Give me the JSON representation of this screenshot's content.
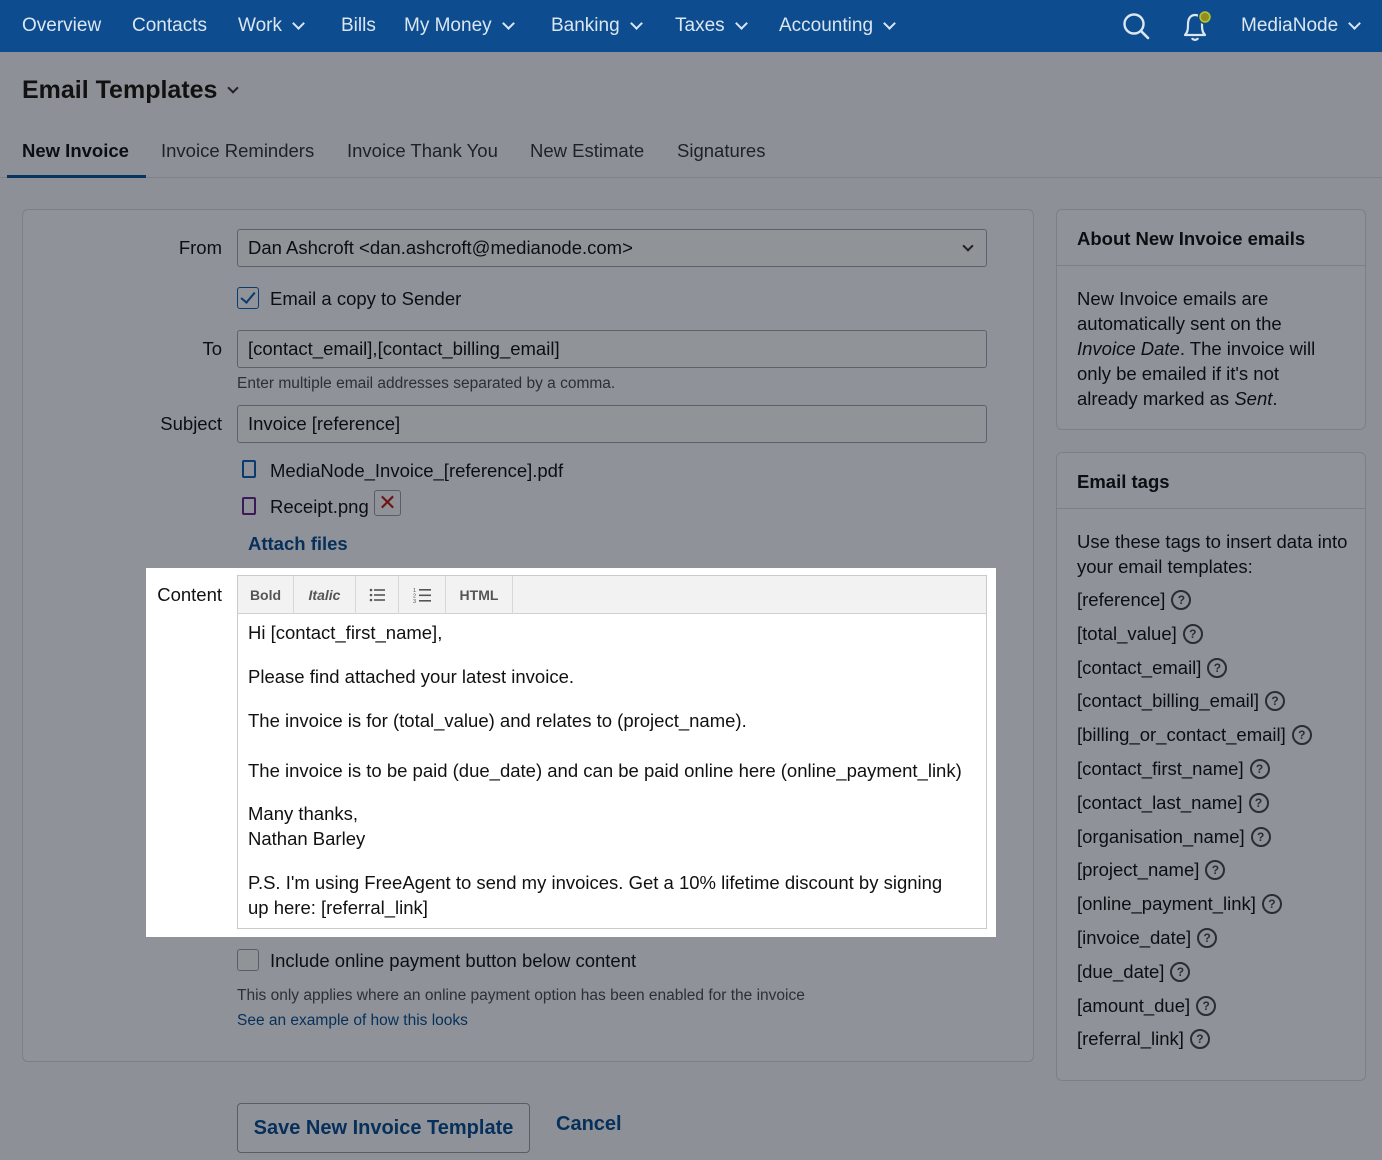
{
  "nav": {
    "items": [
      {
        "label": "Overview"
      },
      {
        "label": "Contacts"
      },
      {
        "label": "Work"
      },
      {
        "label": "Bills"
      },
      {
        "label": "My Money"
      },
      {
        "label": "Banking"
      },
      {
        "label": "Taxes"
      },
      {
        "label": "Accounting"
      }
    ],
    "account_label": "MediaNode"
  },
  "page": {
    "title": "Email Templates",
    "tabs": [
      {
        "label": "New Invoice"
      },
      {
        "label": "Invoice Reminders"
      },
      {
        "label": "Invoice Thank You"
      },
      {
        "label": "New Estimate"
      },
      {
        "label": "Signatures"
      }
    ]
  },
  "form": {
    "from_label": "From",
    "from_value": "Dan Ashcroft <dan.ashcroft@medianode.com>",
    "copy_sender_label": "Email a copy to Sender",
    "copy_sender_checked": true,
    "to_label": "To",
    "to_value": "[contact_email],[contact_billing_email]",
    "to_hint": "Enter multiple email addresses separated by a comma.",
    "subject_label": "Subject",
    "subject_value": "Invoice [reference]",
    "attachments": [
      {
        "name": "MediaNode_Invoice_[reference].pdf",
        "icon": "document-icon"
      },
      {
        "name": "Receipt.png",
        "icon": "image-file-icon"
      }
    ],
    "remove_glyph": "✕",
    "attach_label": "Attach files",
    "content_label": "Content",
    "toolbar": {
      "bold": "Bold",
      "italic": "Italic",
      "html": "HTML"
    },
    "content_lines": [
      "Hi [contact_first_name],",
      "Please find attached your latest invoice.",
      "The invoice is for (total_value) and relates to (project_name).",
      "The invoice is to be paid (due_date) and can be paid online here (online_payment_link)",
      "Many thanks,",
      "Nathan Barley",
      "P.S. I'm using FreeAgent to send my invoices. Get a 10% lifetime discount by signing",
      "up here: [referral_link]"
    ],
    "payment_button_label": "Include online payment button below content",
    "payment_button_checked": false,
    "payment_hint": "This only applies where an online payment option has been enabled for the invoice",
    "example_link": "See an example of how this looks",
    "save_label": "Save New Invoice Template",
    "cancel_label": "Cancel"
  },
  "about": {
    "title": "About New Invoice emails",
    "line1": "New Invoice emails are",
    "line2": "automatically sent on the",
    "line3_italic": "Invoice Date",
    "line3_rest": ". The invoice will",
    "line4": "only be emailed if it's not",
    "line5_prefix": "already marked as ",
    "line5_italic": "Sent",
    "line5_suffix": "."
  },
  "tags": {
    "title": "Email tags",
    "intro_line1": "Use these tags to insert data into",
    "intro_line2": "your email templates:",
    "help_glyph": "?",
    "items": [
      "[reference]",
      "[total_value]",
      "[contact_email]",
      "[contact_billing_email]",
      "[billing_or_contact_email]",
      "[contact_first_name]",
      "[contact_last_name]",
      "[organisation_name]",
      "[project_name]",
      "[online_payment_link]",
      "[invoice_date]",
      "[due_date]",
      "[amount_due]",
      "[referral_link]"
    ]
  },
  "colors": {
    "nav_bg": "#0c4c8f",
    "overlay_bg": "#8d9197",
    "link": "#062f5a",
    "highlight": "#ffffff"
  }
}
